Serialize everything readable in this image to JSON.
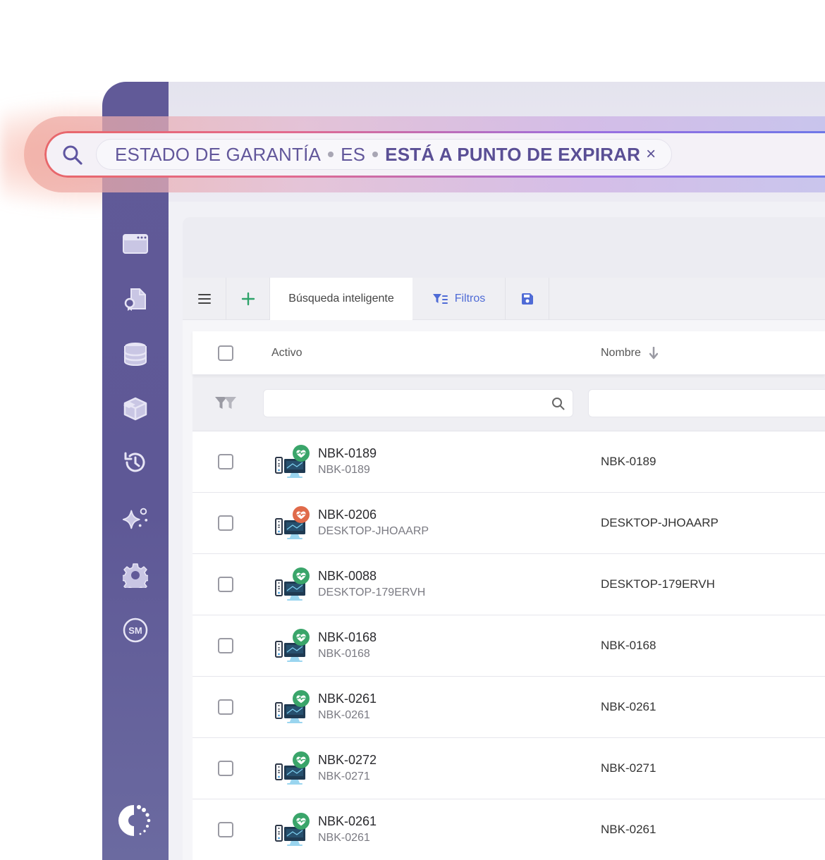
{
  "search": {
    "field": "ESTADO DE GARANTÍA",
    "operator": "ES",
    "value": "ESTÁ A PUNTO DE EXPIRAR",
    "remove_icon": "×"
  },
  "sidebar": {
    "items": [
      {
        "icon": "browser-window-icon"
      },
      {
        "icon": "document-certificate-icon"
      },
      {
        "icon": "database-icon"
      },
      {
        "icon": "box-icon"
      },
      {
        "icon": "history-icon"
      },
      {
        "icon": "sparkles-icon"
      },
      {
        "icon": "gear-icon"
      },
      {
        "icon": "sm-badge-icon",
        "label": "SM"
      }
    ]
  },
  "toolbar": {
    "menu_icon": "hamburger-icon",
    "add_icon": "plus-icon",
    "smart_search_label": "Búsqueda inteligente",
    "filters_label": "Filtros",
    "save_icon": "floppy-disk-icon"
  },
  "table": {
    "columns": [
      "Activo",
      "Nombre"
    ],
    "sort": "Nombre descending",
    "rows": [
      {
        "activo": "NBK-0189",
        "sub": "NBK-0189",
        "nombre": "NBK-0189",
        "health": "good"
      },
      {
        "activo": "NBK-0206",
        "sub": "DESKTOP-JHOAARP",
        "nombre": "DESKTOP-JHOAARP",
        "health": "warning"
      },
      {
        "activo": "NBK-0088",
        "sub": "DESKTOP-179ERVH",
        "nombre": "DESKTOP-179ERVH",
        "health": "good"
      },
      {
        "activo": "NBK-0168",
        "sub": "NBK-0168",
        "nombre": "NBK-0168",
        "health": "good"
      },
      {
        "activo": "NBK-0261",
        "sub": "NBK-0261",
        "nombre": "NBK-0261",
        "health": "good"
      },
      {
        "activo": "NBK-0272",
        "sub": "NBK-0271",
        "nombre": "NBK-0271",
        "health": "good"
      },
      {
        "activo": "NBK-0261",
        "sub": "NBK-0261",
        "nombre": "NBK-0261",
        "health": "good"
      }
    ]
  },
  "colors": {
    "sidebar": "#615a98",
    "accent_blue": "#4f6bd6",
    "health_good": "#3aa56a",
    "health_warning": "#e06a4a"
  }
}
